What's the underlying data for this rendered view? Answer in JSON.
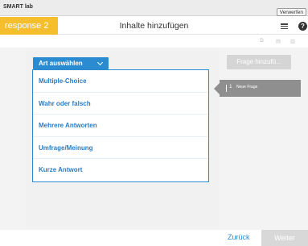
{
  "window": {
    "app_title": "SMART lab",
    "discard_label": "Verwerfen"
  },
  "header": {
    "response_tab": "response 2",
    "title": "Inhalte hinzufügen",
    "help_glyph": "?"
  },
  "toolbar": {
    "icons": [
      "copy-icon",
      "print-icon",
      "trash-icon"
    ]
  },
  "type_picker": {
    "button_label": "Art auswählen",
    "options": [
      "Multiple-Choice",
      "Wahr oder falsch",
      "Mehrere Antworten",
      "Umfrage/Meinung",
      "Kurze Antwort"
    ]
  },
  "questions_panel": {
    "add_button": "Frage hinzufü...",
    "items": [
      {
        "number": "1",
        "label": "Neue Frage"
      }
    ]
  },
  "footer": {
    "back": "Zurück",
    "next": "Weiter"
  },
  "colors": {
    "accent_blue": "#2a8bd1",
    "response_yellow": "#f4be2d",
    "selected_gray": "#8f8f8f"
  }
}
